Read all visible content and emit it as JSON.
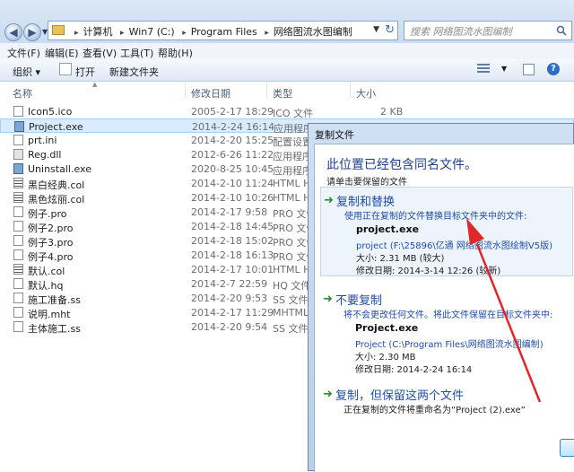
{
  "address": {
    "crumbs": [
      "计算机",
      "Win7 (C:)",
      "Program Files",
      "网络图流水图编制"
    ],
    "search_placeholder": "搜索 网络图流水图编制"
  },
  "menu": [
    "文件(F)",
    "编辑(E)",
    "查看(V)",
    "工具(T)",
    "帮助(H)"
  ],
  "toolbar": {
    "organize": "组织 ▾",
    "open": "打开",
    "new_folder": "新建文件夹"
  },
  "columns": {
    "name": "名称",
    "date": "修改日期",
    "type": "类型",
    "size": "大小"
  },
  "files": [
    {
      "name": "Icon5.ico",
      "date": "2005-2-17 18:29",
      "type": "ICO 文件",
      "size": "2 KB",
      "icon": "ico"
    },
    {
      "name": "Project.exe",
      "date": "2014-2-24 16:14",
      "type": "应用程序",
      "size": "",
      "icon": "exe",
      "selected": true
    },
    {
      "name": "prt.ini",
      "date": "2014-2-20 15:25",
      "type": "配置设置",
      "size": "",
      "icon": "ini"
    },
    {
      "name": "Reg.dll",
      "date": "2012-6-26 11:22",
      "type": "应用程序扩",
      "size": "",
      "icon": "dll"
    },
    {
      "name": "Uninstall.exe",
      "date": "2020-8-25 10:45",
      "type": "应用程序",
      "size": "",
      "icon": "exe"
    },
    {
      "name": "黑白经典.col",
      "date": "2014-2-10 11:24",
      "type": "HTML He",
      "size": "",
      "icon": "col"
    },
    {
      "name": "黑色炫丽.col",
      "date": "2014-2-10 10:26",
      "type": "HTML He",
      "size": "",
      "icon": "col"
    },
    {
      "name": "例子.pro",
      "date": "2014-2-17 9:58",
      "type": "PRO 文件",
      "size": "",
      "icon": "pro"
    },
    {
      "name": "例子2.pro",
      "date": "2014-2-18 14:45",
      "type": "PRO 文件",
      "size": "",
      "icon": "pro"
    },
    {
      "name": "例子3.pro",
      "date": "2014-2-18 15:02",
      "type": "PRO 文件",
      "size": "",
      "icon": "pro"
    },
    {
      "name": "例子4.pro",
      "date": "2014-2-18 16:13",
      "type": "PRO 文件",
      "size": "",
      "icon": "pro"
    },
    {
      "name": "默认.col",
      "date": "2014-2-17 10:01",
      "type": "HTML He",
      "size": "",
      "icon": "col"
    },
    {
      "name": "默认.hq",
      "date": "2014-2-7 22:59",
      "type": "HQ 文件",
      "size": "",
      "icon": "hq"
    },
    {
      "name": "施工准备.ss",
      "date": "2014-2-20 9:53",
      "type": "SS 文件",
      "size": "",
      "icon": "ss"
    },
    {
      "name": "说明.mht",
      "date": "2014-2-17 11:29",
      "type": "MHTML",
      "size": "",
      "icon": "mht"
    },
    {
      "name": "主体施工.ss",
      "date": "2014-2-20 9:54",
      "type": "SS 文件",
      "size": "",
      "icon": "ss"
    }
  ],
  "dialog": {
    "title": "复制文件",
    "heading": "此位置已经包含同名文件。",
    "subheading": "请单击要保留的文件",
    "option_replace": {
      "title": "复制和替换",
      "desc": "使用正在复制的文件替换目标文件夹中的文件:",
      "file": "project.exe",
      "path": "project (F:\\25896\\亿通 网络图流水图绘制V5版)",
      "size": "大小: 2.31 MB (较大)",
      "date": "修改日期: 2014-3-14 12:26 (较新)"
    },
    "option_skip": {
      "title": "不要复制",
      "desc": "将不会更改任何文件。将此文件保留在目标文件夹中:",
      "file": "Project.exe",
      "path": "Project (C:\\Program Files\\网络图流水图编制)",
      "size": "大小: 2.30 MB",
      "date": "修改日期: 2014-2-24 16:14"
    },
    "option_keep_both": {
      "title": "复制，但保留这两个文件",
      "desc": "正在复制的文件将重命名为“Project (2).exe”"
    }
  }
}
